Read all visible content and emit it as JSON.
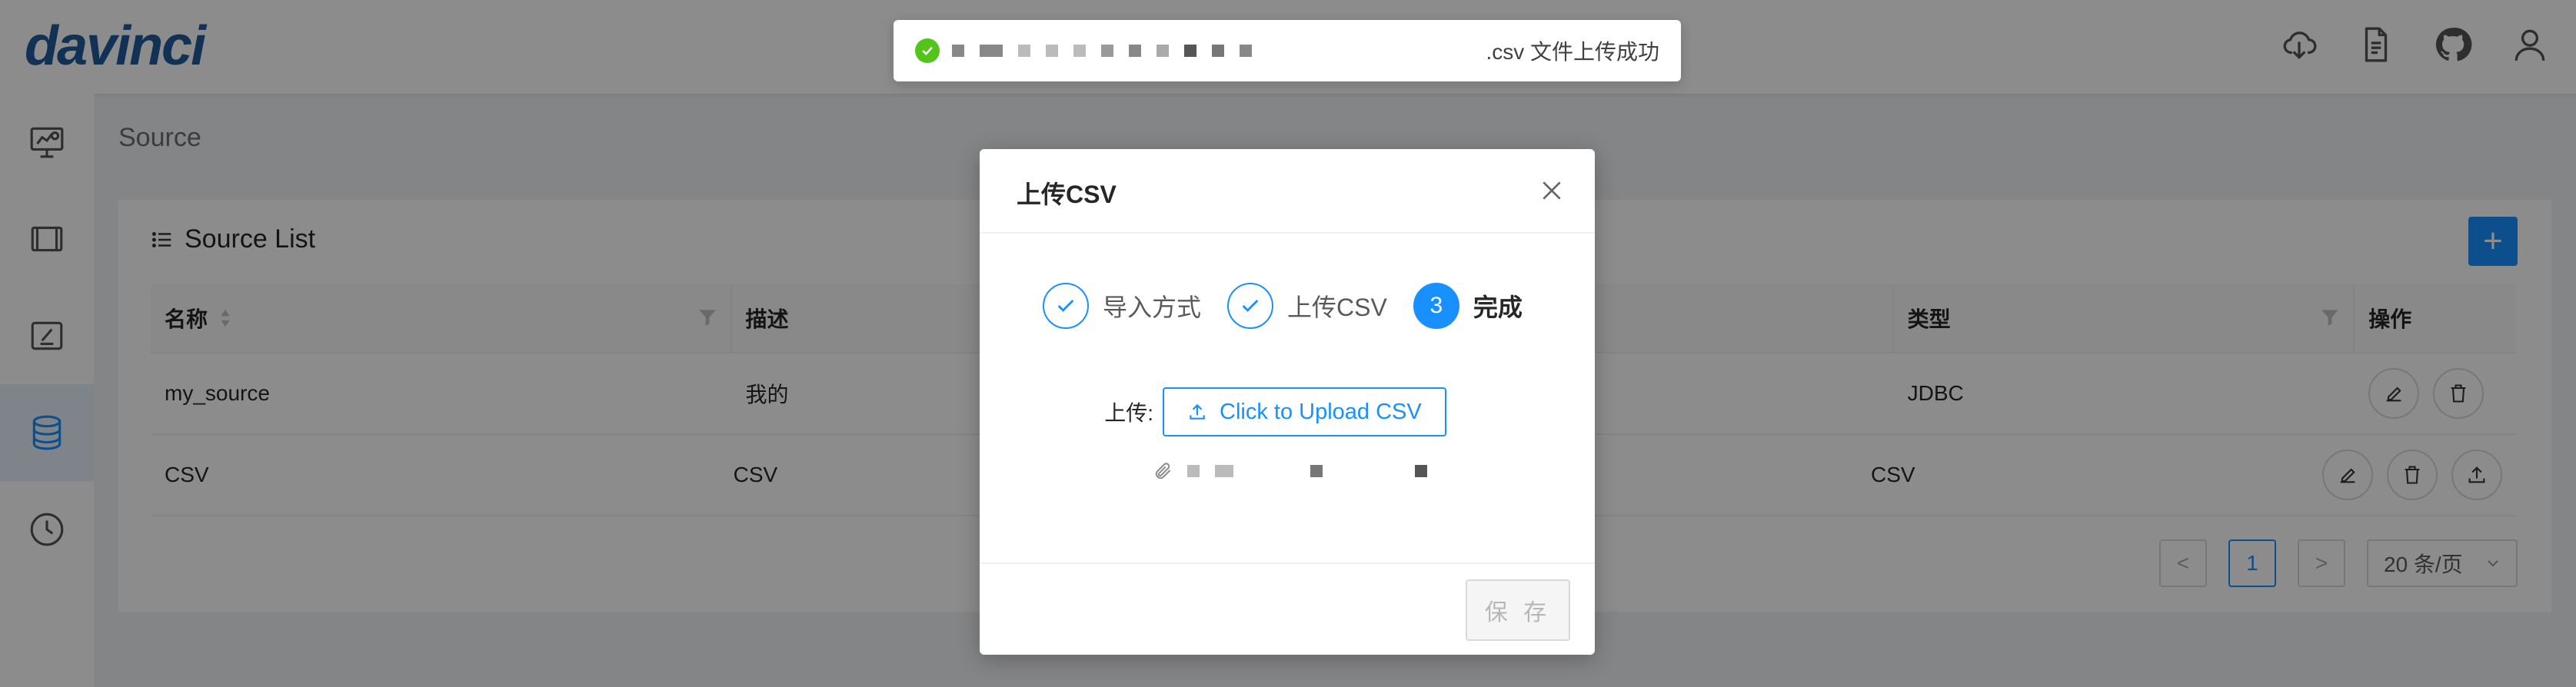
{
  "header": {
    "logo_text": "davinci",
    "icons": [
      "cloud-download-icon",
      "file-icon",
      "github-icon",
      "user-icon"
    ]
  },
  "sidebar": {
    "items": [
      {
        "icon": "dashboard-icon"
      },
      {
        "icon": "view-icon"
      },
      {
        "icon": "edit-icon"
      },
      {
        "icon": "database-icon",
        "active": true
      },
      {
        "icon": "clock-icon"
      }
    ]
  },
  "main": {
    "breadcrumb": "Source",
    "card_title": "Source List",
    "add_label": "+",
    "table": {
      "columns": [
        "名称",
        "描述",
        "",
        "类型",
        "操作"
      ],
      "rows": [
        {
          "name": "my_source",
          "desc": "我的",
          "type": "JDBC"
        },
        {
          "name": "CSV",
          "desc": "CSV",
          "type": "CSV"
        }
      ]
    },
    "pagination": {
      "prev": "<",
      "current": "1",
      "next": ">",
      "page_size": "20 条/页"
    }
  },
  "modal": {
    "title": "上传CSV",
    "steps": [
      {
        "label": "导入方式",
        "status": "done"
      },
      {
        "label": "上传CSV",
        "status": "done"
      },
      {
        "label": "完成",
        "number": "3",
        "status": "current"
      }
    ],
    "upload_label": "上传:",
    "upload_button": "Click to Upload CSV",
    "save_button": "保 存"
  },
  "toast": {
    "text": ".csv 文件上传成功"
  },
  "colors": {
    "accent": "#1890ff",
    "success": "#52c41a",
    "logo": "#1f5c99"
  }
}
